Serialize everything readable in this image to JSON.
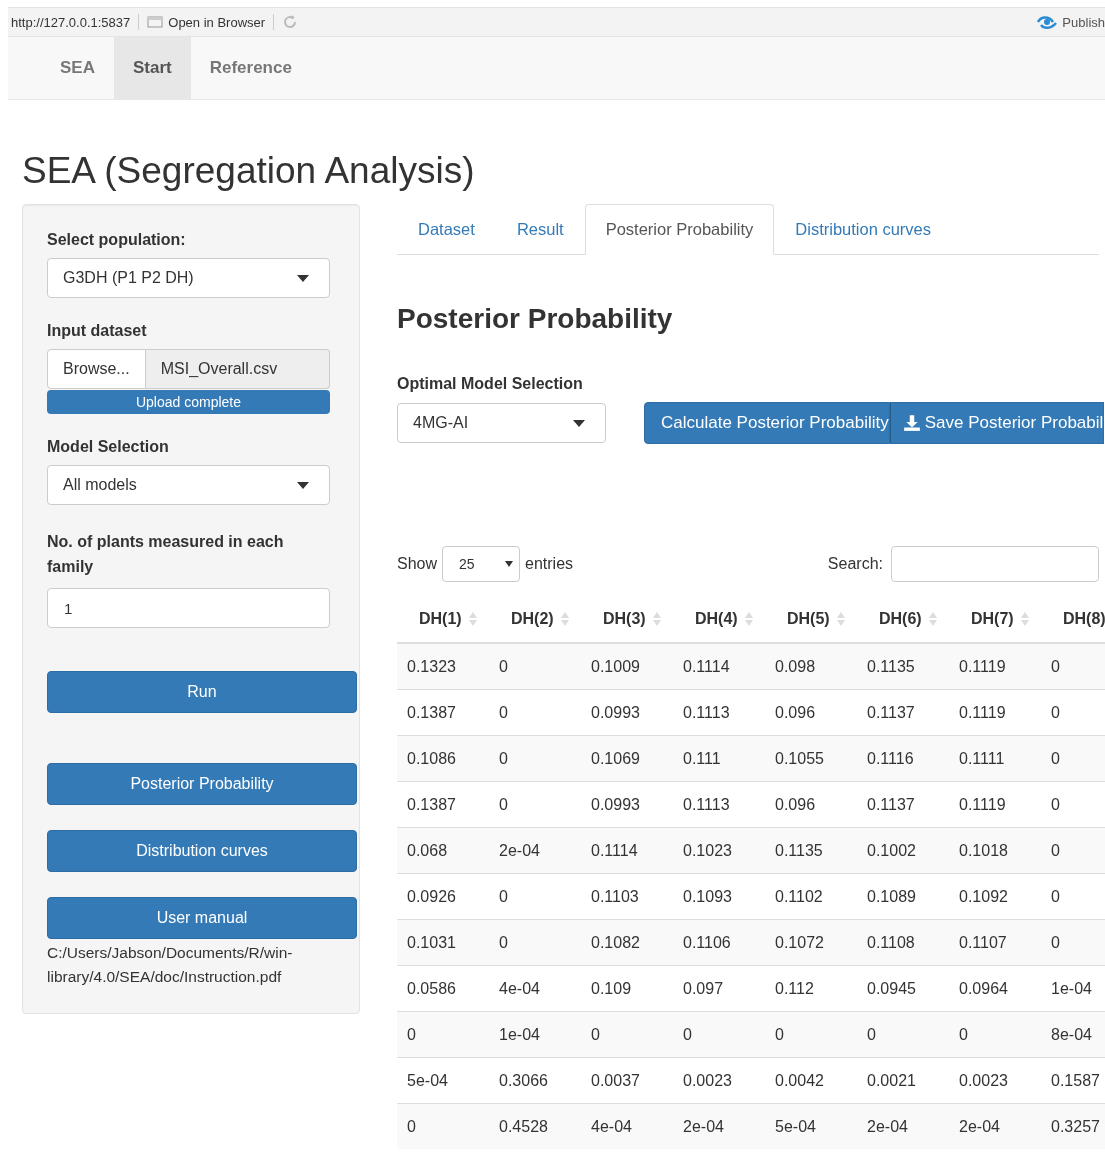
{
  "browser_bar": {
    "url": "http://127.0.0.1:5837",
    "open_label": "Open in Browser",
    "publish_label": "Publish"
  },
  "navbar": {
    "brand": "SEA",
    "items": [
      {
        "label": "Start",
        "selected": true
      },
      {
        "label": "Reference",
        "selected": false
      }
    ]
  },
  "title": "SEA (Segregation Analysis)",
  "sidebar": {
    "population_label": "Select population:",
    "population_value": "G3DH (P1 P2 DH)",
    "dataset_label": "Input dataset",
    "browse_label": "Browse...",
    "file_name": "MSI_Overall.csv",
    "upload": {
      "status": "Upload complete",
      "level": 1
    },
    "model_label": "Model Selection",
    "model_value": "All models",
    "plants_label": "No. of plants measured in each family",
    "plants_value": "1",
    "run_button": "Run",
    "buttons": [
      "Posterior Probability",
      "Distribution curves",
      "User manual"
    ],
    "manual_path": "C:/Users/Jabson/Documents/R/win-library/4.0/SEA/doc/Instruction.pdf"
  },
  "tabs": [
    {
      "label": "Dataset",
      "selected": false
    },
    {
      "label": "Result",
      "selected": false
    },
    {
      "label": "Posterior Probability",
      "selected": true
    },
    {
      "label": "Distribution curves",
      "selected": false
    }
  ],
  "panel": {
    "heading": "Posterior Probability",
    "model_label": "Optimal Model Selection",
    "model_value": "4MG-AI",
    "calc_button": "Calculate Posterior Probability",
    "save_button": "Save Posterior Probabil"
  },
  "table": {
    "show_label": "Show",
    "page_size": "25",
    "entries_label": "entries",
    "search_label": "Search:",
    "columns": [
      "DH(1)",
      "DH(2)",
      "DH(3)",
      "DH(4)",
      "DH(5)",
      "DH(6)",
      "DH(7)",
      "DH(8)"
    ],
    "rows": [
      [
        "0.1323",
        "0",
        "0.1009",
        "0.1114",
        "0.098",
        "0.1135",
        "0.1119",
        "0"
      ],
      [
        "0.1387",
        "0",
        "0.0993",
        "0.1113",
        "0.096",
        "0.1137",
        "0.1119",
        "0"
      ],
      [
        "0.1086",
        "0",
        "0.1069",
        "0.111",
        "0.1055",
        "0.1116",
        "0.1111",
        "0"
      ],
      [
        "0.1387",
        "0",
        "0.0993",
        "0.1113",
        "0.096",
        "0.1137",
        "0.1119",
        "0"
      ],
      [
        "0.068",
        "2e-04",
        "0.1114",
        "0.1023",
        "0.1135",
        "0.1002",
        "0.1018",
        "0"
      ],
      [
        "0.0926",
        "0",
        "0.1103",
        "0.1093",
        "0.1102",
        "0.1089",
        "0.1092",
        "0"
      ],
      [
        "0.1031",
        "0",
        "0.1082",
        "0.1106",
        "0.1072",
        "0.1108",
        "0.1107",
        "0"
      ],
      [
        "0.0586",
        "4e-04",
        "0.109",
        "0.097",
        "0.112",
        "0.0945",
        "0.0964",
        "1e-04"
      ],
      [
        "0",
        "1e-04",
        "0",
        "0",
        "0",
        "0",
        "0",
        "8e-04"
      ],
      [
        "5e-04",
        "0.3066",
        "0.0037",
        "0.0023",
        "0.0042",
        "0.0021",
        "0.0023",
        "0.1587"
      ],
      [
        "0",
        "0.4528",
        "4e-04",
        "2e-04",
        "5e-04",
        "2e-04",
        "2e-04",
        "0.3257"
      ]
    ]
  }
}
